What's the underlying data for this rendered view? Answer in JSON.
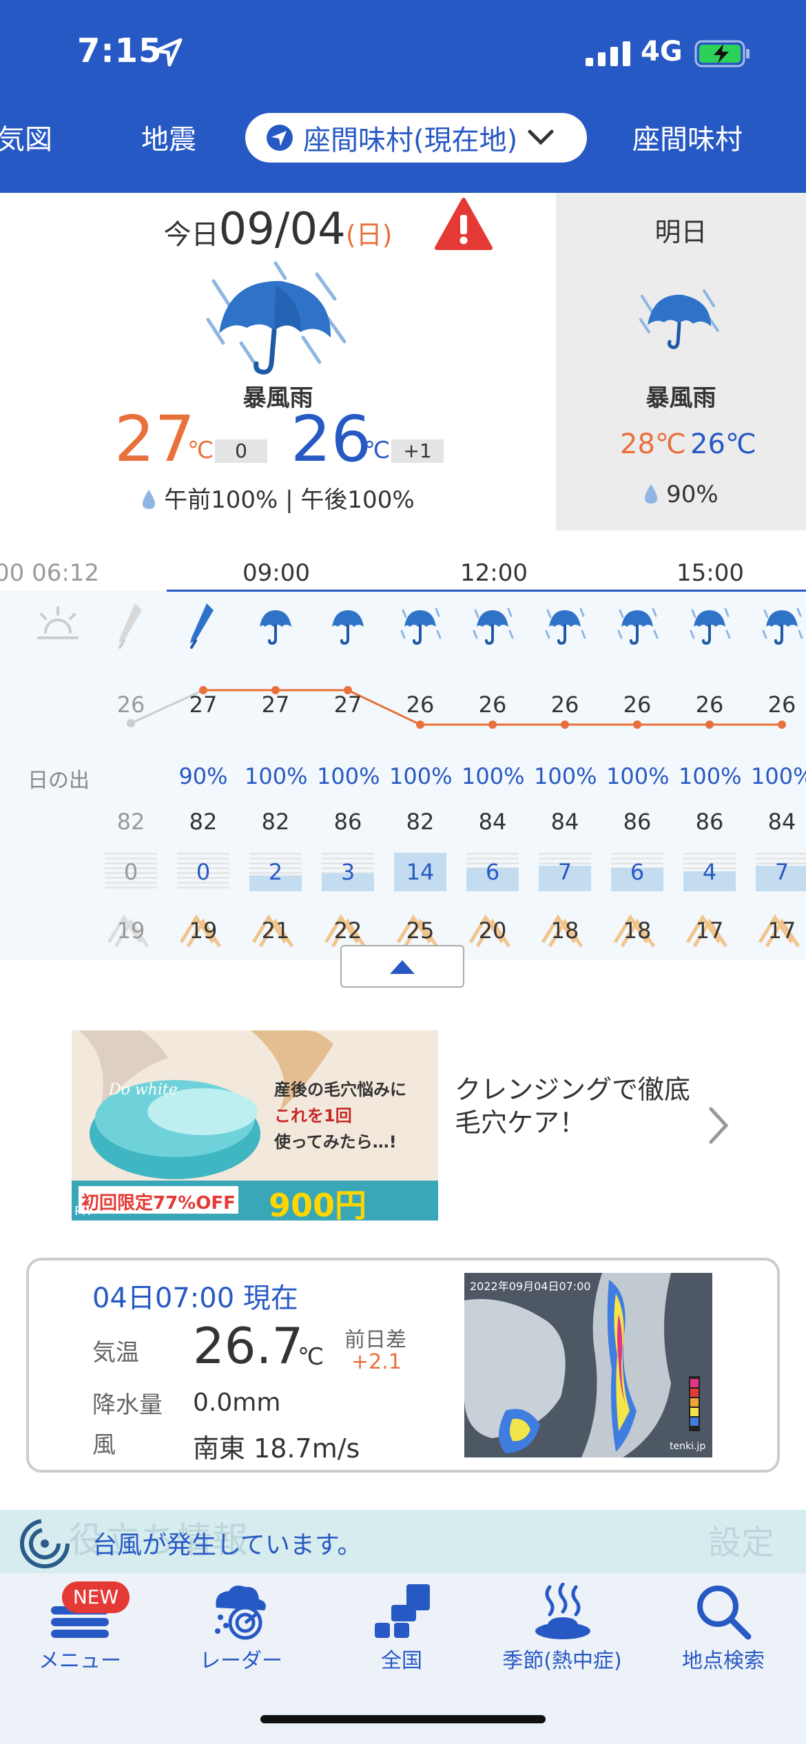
{
  "status": {
    "time": "7:15",
    "network": "4G"
  },
  "tabs": {
    "partial_left": "気図",
    "earthquake": "地震",
    "current": "座間味村(現在地)",
    "partial_right": "座間味村"
  },
  "today": {
    "label": "今日",
    "date": "09/04",
    "weekday": "(日)",
    "weather": "暴風雨",
    "high": "27",
    "high_unit": "℃",
    "high_diff": "0",
    "low": "26",
    "low_unit": "℃",
    "low_diff": "+1",
    "rain": "午前100% | 午後100%"
  },
  "tomorrow": {
    "label": "明日",
    "weather": "暴風雨",
    "high": "28℃",
    "low": "26℃",
    "rain": "90%"
  },
  "hourly": {
    "headers": [
      "00 06:12",
      "09:00",
      "12:00",
      "15:00"
    ],
    "sunrise_label": "日の出",
    "icons": [
      "sunrise-icon",
      "umbrella-closed-icon",
      "umbrella-closed-icon",
      "umbrella-icon",
      "umbrella-icon",
      "umbrella-rain-icon",
      "umbrella-rain-icon",
      "umbrella-rain-icon",
      "umbrella-rain-icon",
      "umbrella-rain-icon",
      "umbrella-rain-icon"
    ],
    "temps": [
      "26",
      "27",
      "27",
      "27",
      "26",
      "26",
      "26",
      "26",
      "26",
      "26"
    ],
    "precip_prob": [
      "90%",
      "100%",
      "100%",
      "100%",
      "100%",
      "100%",
      "100%",
      "100%",
      "100%"
    ],
    "humidity": [
      "82",
      "82",
      "82",
      "86",
      "82",
      "84",
      "84",
      "86",
      "86",
      "84"
    ],
    "precip_mm": [
      "0",
      "0",
      "2",
      "3",
      "14",
      "6",
      "7",
      "6",
      "4",
      "7"
    ],
    "wind": [
      "19",
      "19",
      "21",
      "22",
      "25",
      "20",
      "18",
      "18",
      "17",
      "17"
    ]
  },
  "ad": {
    "text": "クレンジングで徹底毛穴ケア！",
    "brand": "Do white",
    "headline1": "産後の毛穴悩みに",
    "headline2": "これを1回",
    "headline3": "使ってみたら…!",
    "offer": "初回限定77%OFF",
    "price": "900円",
    "pr": "PR"
  },
  "observation": {
    "title": "04日07:00 現在",
    "temp_label": "気温",
    "temp": "26.7",
    "temp_unit": "℃",
    "prev_label": "前日差",
    "prev_diff": "+2.1",
    "precip_label": "降水量",
    "precip": "0.0mm",
    "wind_label": "風",
    "wind": "南東 18.7m/s",
    "radar_timestamp": "2022年09月04日07:00",
    "radar_brand": "tenki.jp"
  },
  "typhoon": {
    "text": "台風が発生しています。",
    "ghost_left": "役立ち情報",
    "ghost_right": "設定"
  },
  "tabbar": {
    "badge": "NEW",
    "items": [
      "メニュー",
      "レーダー",
      "全国",
      "季節(熱中症)",
      "地点検索"
    ]
  }
}
